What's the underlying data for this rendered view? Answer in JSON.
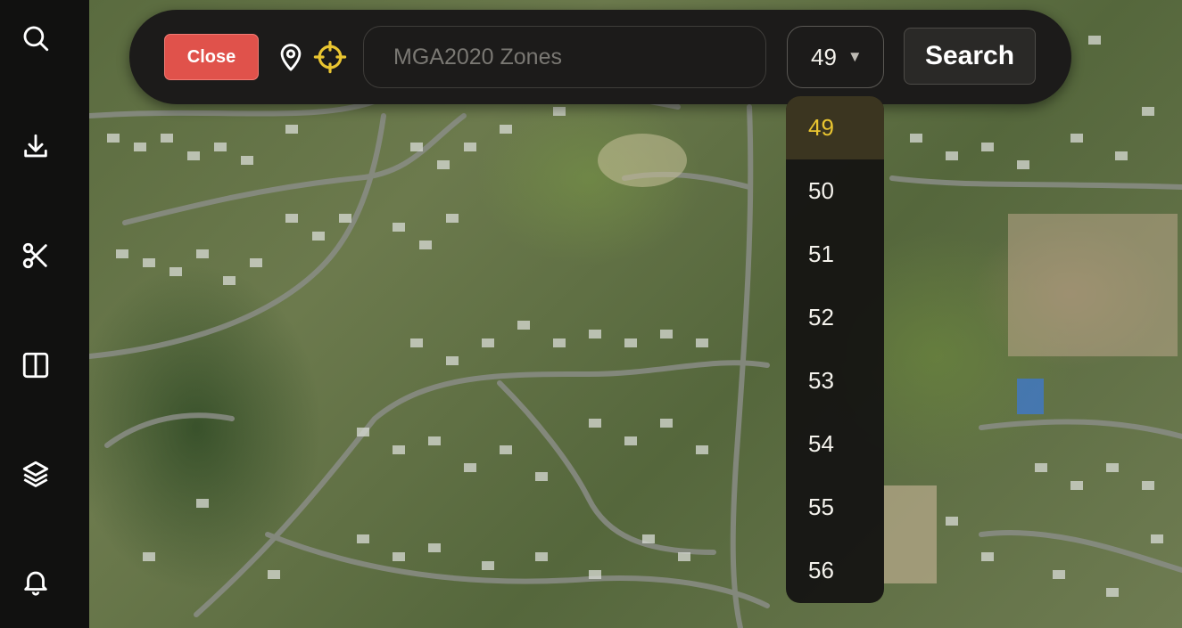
{
  "sidebar": {
    "items": [
      {
        "name": "search-icon"
      },
      {
        "name": "download-icon"
      },
      {
        "name": "scissors-icon"
      },
      {
        "name": "split-view-icon"
      },
      {
        "name": "layers-icon"
      },
      {
        "name": "bell-icon"
      }
    ]
  },
  "toolbar": {
    "close_label": "Close",
    "pin_icon": "map-pin-icon",
    "locate_icon": "crosshair-icon",
    "search_placeholder": "MGA2020 Zones",
    "search_value": "",
    "zone_selected": "49",
    "zone_chevron": "▼",
    "search_label": "Search"
  },
  "dropdown": {
    "selected": "49",
    "options": [
      "49",
      "50",
      "51",
      "52",
      "53",
      "54",
      "55",
      "56"
    ]
  },
  "colors": {
    "close": "#e0524b",
    "accent": "#e9c531",
    "panel": "#1c1b1a",
    "rail": "#111110"
  }
}
